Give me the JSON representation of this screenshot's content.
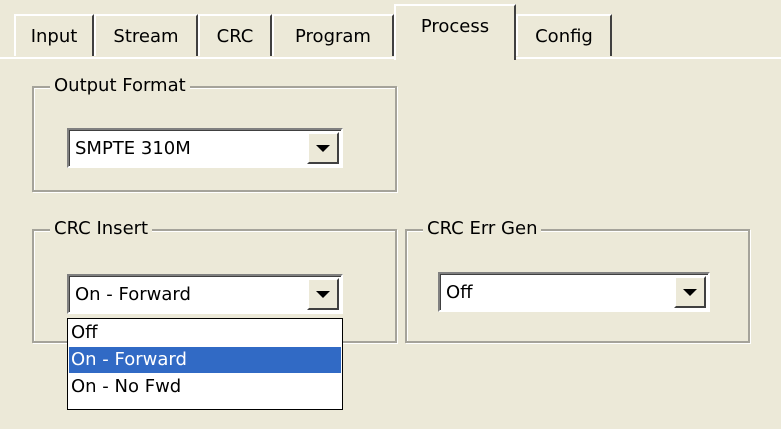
{
  "tabs": [
    {
      "label": "Input",
      "active": false
    },
    {
      "label": "Stream",
      "active": false
    },
    {
      "label": "CRC",
      "active": false
    },
    {
      "label": "Program",
      "active": false
    },
    {
      "label": "Process",
      "active": true
    },
    {
      "label": "Config",
      "active": false
    }
  ],
  "output_format": {
    "title": "Output Format",
    "value": "SMPTE 310M"
  },
  "crc_insert": {
    "title": "CRC Insert",
    "value": "On - Forward",
    "options": [
      "Off",
      "On - Forward",
      "On - No Fwd"
    ],
    "highlighted": "On - Forward"
  },
  "crc_err_gen": {
    "title": "CRC Err Gen",
    "value": "Off"
  },
  "colors": {
    "face": "#ece9d8",
    "highlight": "#316ac5"
  }
}
